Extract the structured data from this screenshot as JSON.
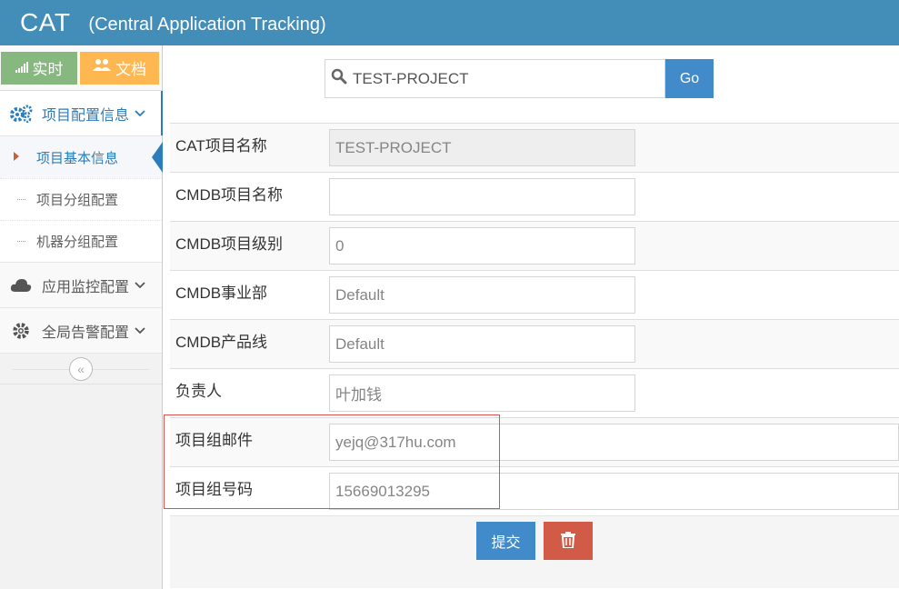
{
  "header": {
    "brand": "CAT",
    "subtitle": "(Central Application Tracking)"
  },
  "sidebar": {
    "shortcuts": [
      {
        "label": "实时",
        "icon": "signal-icon"
      },
      {
        "label": "文档",
        "icon": "users-icon"
      }
    ],
    "menu": [
      {
        "label": "项目配置信息",
        "icon": "cogs-icon",
        "open": true,
        "children": [
          {
            "label": "项目基本信息",
            "active": true
          },
          {
            "label": "项目分组配置"
          },
          {
            "label": "机器分组配置"
          }
        ]
      },
      {
        "label": "应用监控配置",
        "icon": "cloud-icon"
      },
      {
        "label": "全局告警配置",
        "icon": "gear-icon"
      }
    ],
    "collapse_glyph": "«"
  },
  "search": {
    "value": "TEST-PROJECT",
    "go_label": "Go"
  },
  "form": {
    "rows": [
      {
        "label": "CAT项目名称",
        "value": "TEST-PROJECT",
        "readonly": true
      },
      {
        "label": "CMDB项目名称",
        "value": ""
      },
      {
        "label": "CMDB项目级别",
        "value": "0"
      },
      {
        "label": "CMDB事业部",
        "value": "Default"
      },
      {
        "label": "CMDB产品线",
        "value": "Default"
      },
      {
        "label": "负责人",
        "value": "叶加钱"
      },
      {
        "label": "项目组邮件",
        "value": "yejq@317hu.com"
      },
      {
        "label": "项目组号码",
        "value": "15669013295"
      }
    ],
    "submit_label": "提交"
  },
  "colors": {
    "navbar": "#438eb9",
    "primary": "#428bca",
    "success": "#87b87f",
    "warning": "#ffb752",
    "danger": "#d15b47",
    "highlight_box": "#d9534f"
  }
}
